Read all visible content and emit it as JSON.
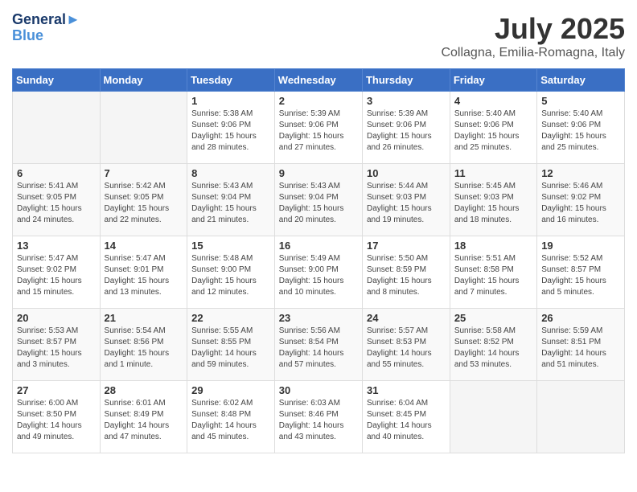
{
  "header": {
    "logo_line1": "General",
    "logo_line2": "Blue",
    "month": "July 2025",
    "location": "Collagna, Emilia-Romagna, Italy"
  },
  "weekdays": [
    "Sunday",
    "Monday",
    "Tuesday",
    "Wednesday",
    "Thursday",
    "Friday",
    "Saturday"
  ],
  "weeks": [
    [
      {
        "day": "",
        "sunrise": "",
        "sunset": "",
        "daylight": ""
      },
      {
        "day": "",
        "sunrise": "",
        "sunset": "",
        "daylight": ""
      },
      {
        "day": "1",
        "sunrise": "Sunrise: 5:38 AM",
        "sunset": "Sunset: 9:06 PM",
        "daylight": "Daylight: 15 hours and 28 minutes."
      },
      {
        "day": "2",
        "sunrise": "Sunrise: 5:39 AM",
        "sunset": "Sunset: 9:06 PM",
        "daylight": "Daylight: 15 hours and 27 minutes."
      },
      {
        "day": "3",
        "sunrise": "Sunrise: 5:39 AM",
        "sunset": "Sunset: 9:06 PM",
        "daylight": "Daylight: 15 hours and 26 minutes."
      },
      {
        "day": "4",
        "sunrise": "Sunrise: 5:40 AM",
        "sunset": "Sunset: 9:06 PM",
        "daylight": "Daylight: 15 hours and 25 minutes."
      },
      {
        "day": "5",
        "sunrise": "Sunrise: 5:40 AM",
        "sunset": "Sunset: 9:06 PM",
        "daylight": "Daylight: 15 hours and 25 minutes."
      }
    ],
    [
      {
        "day": "6",
        "sunrise": "Sunrise: 5:41 AM",
        "sunset": "Sunset: 9:05 PM",
        "daylight": "Daylight: 15 hours and 24 minutes."
      },
      {
        "day": "7",
        "sunrise": "Sunrise: 5:42 AM",
        "sunset": "Sunset: 9:05 PM",
        "daylight": "Daylight: 15 hours and 22 minutes."
      },
      {
        "day": "8",
        "sunrise": "Sunrise: 5:43 AM",
        "sunset": "Sunset: 9:04 PM",
        "daylight": "Daylight: 15 hours and 21 minutes."
      },
      {
        "day": "9",
        "sunrise": "Sunrise: 5:43 AM",
        "sunset": "Sunset: 9:04 PM",
        "daylight": "Daylight: 15 hours and 20 minutes."
      },
      {
        "day": "10",
        "sunrise": "Sunrise: 5:44 AM",
        "sunset": "Sunset: 9:03 PM",
        "daylight": "Daylight: 15 hours and 19 minutes."
      },
      {
        "day": "11",
        "sunrise": "Sunrise: 5:45 AM",
        "sunset": "Sunset: 9:03 PM",
        "daylight": "Daylight: 15 hours and 18 minutes."
      },
      {
        "day": "12",
        "sunrise": "Sunrise: 5:46 AM",
        "sunset": "Sunset: 9:02 PM",
        "daylight": "Daylight: 15 hours and 16 minutes."
      }
    ],
    [
      {
        "day": "13",
        "sunrise": "Sunrise: 5:47 AM",
        "sunset": "Sunset: 9:02 PM",
        "daylight": "Daylight: 15 hours and 15 minutes."
      },
      {
        "day": "14",
        "sunrise": "Sunrise: 5:47 AM",
        "sunset": "Sunset: 9:01 PM",
        "daylight": "Daylight: 15 hours and 13 minutes."
      },
      {
        "day": "15",
        "sunrise": "Sunrise: 5:48 AM",
        "sunset": "Sunset: 9:00 PM",
        "daylight": "Daylight: 15 hours and 12 minutes."
      },
      {
        "day": "16",
        "sunrise": "Sunrise: 5:49 AM",
        "sunset": "Sunset: 9:00 PM",
        "daylight": "Daylight: 15 hours and 10 minutes."
      },
      {
        "day": "17",
        "sunrise": "Sunrise: 5:50 AM",
        "sunset": "Sunset: 8:59 PM",
        "daylight": "Daylight: 15 hours and 8 minutes."
      },
      {
        "day": "18",
        "sunrise": "Sunrise: 5:51 AM",
        "sunset": "Sunset: 8:58 PM",
        "daylight": "Daylight: 15 hours and 7 minutes."
      },
      {
        "day": "19",
        "sunrise": "Sunrise: 5:52 AM",
        "sunset": "Sunset: 8:57 PM",
        "daylight": "Daylight: 15 hours and 5 minutes."
      }
    ],
    [
      {
        "day": "20",
        "sunrise": "Sunrise: 5:53 AM",
        "sunset": "Sunset: 8:57 PM",
        "daylight": "Daylight: 15 hours and 3 minutes."
      },
      {
        "day": "21",
        "sunrise": "Sunrise: 5:54 AM",
        "sunset": "Sunset: 8:56 PM",
        "daylight": "Daylight: 15 hours and 1 minute."
      },
      {
        "day": "22",
        "sunrise": "Sunrise: 5:55 AM",
        "sunset": "Sunset: 8:55 PM",
        "daylight": "Daylight: 14 hours and 59 minutes."
      },
      {
        "day": "23",
        "sunrise": "Sunrise: 5:56 AM",
        "sunset": "Sunset: 8:54 PM",
        "daylight": "Daylight: 14 hours and 57 minutes."
      },
      {
        "day": "24",
        "sunrise": "Sunrise: 5:57 AM",
        "sunset": "Sunset: 8:53 PM",
        "daylight": "Daylight: 14 hours and 55 minutes."
      },
      {
        "day": "25",
        "sunrise": "Sunrise: 5:58 AM",
        "sunset": "Sunset: 8:52 PM",
        "daylight": "Daylight: 14 hours and 53 minutes."
      },
      {
        "day": "26",
        "sunrise": "Sunrise: 5:59 AM",
        "sunset": "Sunset: 8:51 PM",
        "daylight": "Daylight: 14 hours and 51 minutes."
      }
    ],
    [
      {
        "day": "27",
        "sunrise": "Sunrise: 6:00 AM",
        "sunset": "Sunset: 8:50 PM",
        "daylight": "Daylight: 14 hours and 49 minutes."
      },
      {
        "day": "28",
        "sunrise": "Sunrise: 6:01 AM",
        "sunset": "Sunset: 8:49 PM",
        "daylight": "Daylight: 14 hours and 47 minutes."
      },
      {
        "day": "29",
        "sunrise": "Sunrise: 6:02 AM",
        "sunset": "Sunset: 8:48 PM",
        "daylight": "Daylight: 14 hours and 45 minutes."
      },
      {
        "day": "30",
        "sunrise": "Sunrise: 6:03 AM",
        "sunset": "Sunset: 8:46 PM",
        "daylight": "Daylight: 14 hours and 43 minutes."
      },
      {
        "day": "31",
        "sunrise": "Sunrise: 6:04 AM",
        "sunset": "Sunset: 8:45 PM",
        "daylight": "Daylight: 14 hours and 40 minutes."
      },
      {
        "day": "",
        "sunrise": "",
        "sunset": "",
        "daylight": ""
      },
      {
        "day": "",
        "sunrise": "",
        "sunset": "",
        "daylight": ""
      }
    ]
  ]
}
